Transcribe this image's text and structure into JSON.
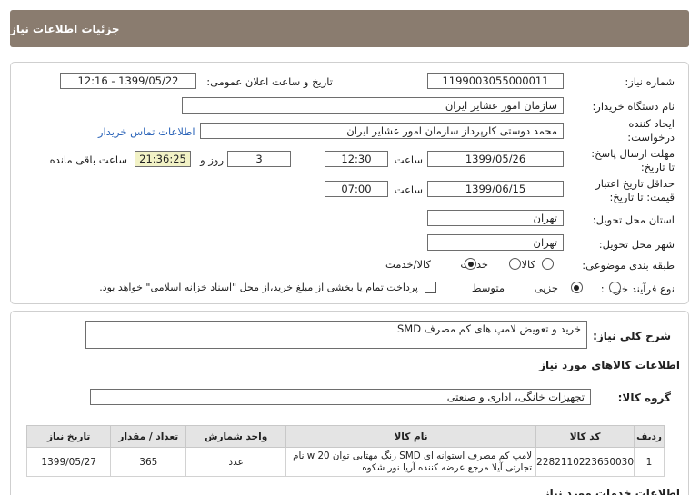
{
  "header": {
    "title": "جزئیات اطلاعات نیاز"
  },
  "form": {
    "need_number_label": "شماره نیاز:",
    "need_number": "1199003055000011",
    "announce_label": "تاریخ و ساعت اعلان عمومی:",
    "announce_value": "1399/05/22 - 12:16",
    "buyer_org_label": "نام دستگاه خریدار:",
    "buyer_org": "سازمان امور عشایر ایران",
    "creator_label_line1": "ایجاد کننده",
    "creator_label_line2": "درخواست:",
    "creator": "محمد دوستی کارپرداز سازمان امور عشایر ایران",
    "contact_link": "اطلاعات تماس خریدار",
    "deadline_label_line1": "مهلت ارسال پاسخ:",
    "deadline_label_line2": "تا تاریخ:",
    "deadline_date": "1399/05/26",
    "time_label": "ساعت",
    "deadline_time": "12:30",
    "days_value": "3",
    "days_label": "روز و",
    "remaining_time": "21:36:25",
    "remaining_label": "ساعت باقی مانده",
    "validity_label_line1": "حداقل تاریخ اعتبار",
    "validity_label_line2": "قیمت: تا تاریخ:",
    "validity_date": "1399/06/15",
    "validity_time_label": "ساعت",
    "validity_time": "07:00",
    "province_label": "استان محل تحویل:",
    "province": "تهران",
    "city_label": "شهر محل تحویل:",
    "city": "تهران",
    "category_label": "طبقه بندی موضوعی:",
    "category_options": [
      "کالا",
      "خدمت",
      "کالا/خدمت"
    ],
    "process_label": "نوع فرآیند خرید :",
    "process_options": [
      "جزیی",
      "متوسط"
    ],
    "payment_note": "پرداخت تمام یا بخشی از مبلغ خرید،از محل \"اسناد خزانه اسلامی\" خواهد بود."
  },
  "summary": {
    "label": "شرح کلی نیاز:",
    "value": "خرید و تعویض لامپ های کم مصرف SMD"
  },
  "goods": {
    "section_title": "اطلاعات کالاهای مورد نیاز",
    "group_label": "گروه کالا:",
    "group_value": "تجهیزات خانگی، اداری و صنعتی",
    "table": {
      "headers": [
        "ردیف",
        "کد کالا",
        "نام کالا",
        "واحد شمارش",
        "تعداد / مقدار",
        "تاریخ نیاز"
      ],
      "rows": [
        {
          "index": "1",
          "code": "2282110223650030",
          "name": "لامپ کم مصرف استوانه ای SMD رنگ مهتابی توان w 20 نام تجارتی آیلا مرجع عرضه کننده آریا نور شکوه",
          "unit": "عدد",
          "qty": "365",
          "date": "1399/05/27"
        }
      ]
    }
  },
  "services": {
    "section_title": "اطلاعات خدمات مورد نیاز"
  },
  "colors": {
    "header_bg": "#8a7c6f",
    "link": "#2a63b8",
    "highlight": "#f2f2c6"
  }
}
